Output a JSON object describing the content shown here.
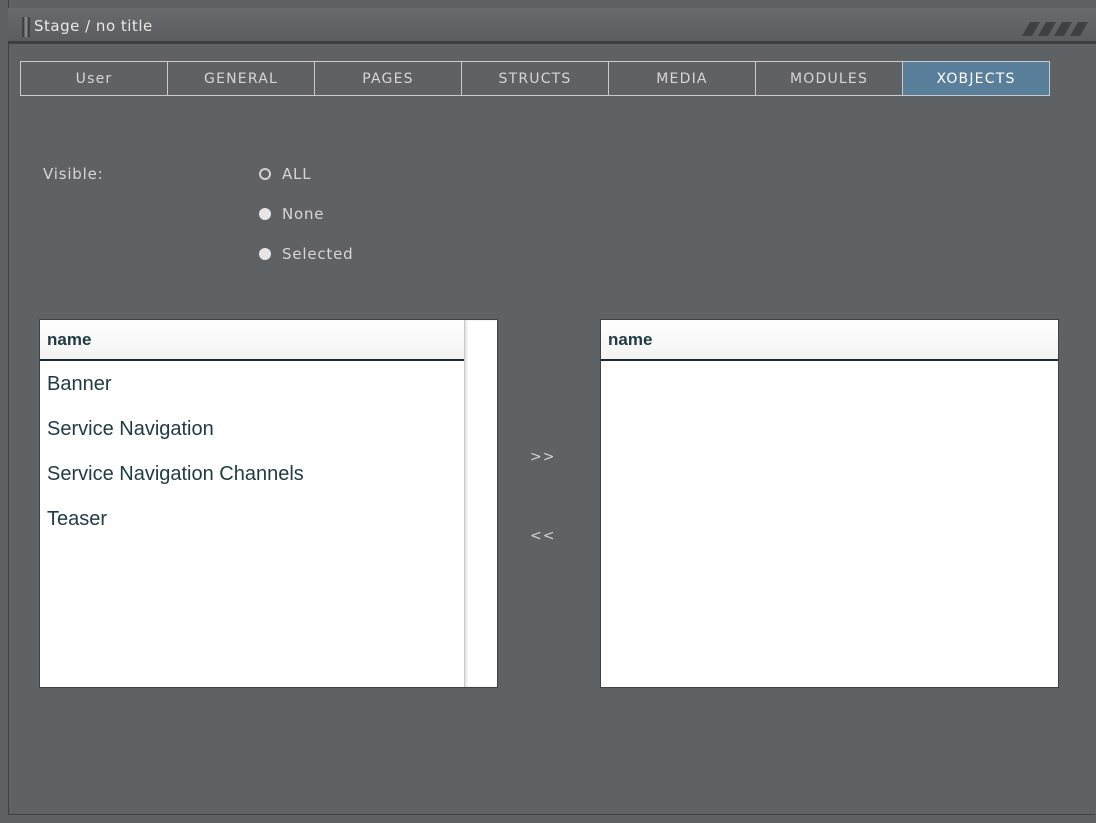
{
  "window": {
    "title": "Stage / no title"
  },
  "tabs": [
    {
      "label": "User",
      "active": false
    },
    {
      "label": "GENERAL",
      "active": false
    },
    {
      "label": "PAGES",
      "active": false
    },
    {
      "label": "STRUCTS",
      "active": false
    },
    {
      "label": "MEDIA",
      "active": false
    },
    {
      "label": "MODULES",
      "active": false
    },
    {
      "label": "XOBJECTS",
      "active": true
    }
  ],
  "visibility": {
    "label": "Visible:",
    "options": [
      {
        "label": "ALL",
        "selected": true
      },
      {
        "label": "None",
        "selected": false
      },
      {
        "label": "Selected",
        "selected": false
      }
    ]
  },
  "available_list": {
    "header": "name",
    "items": [
      "Banner",
      "Service Navigation",
      "Service Navigation Channels",
      "Teaser"
    ]
  },
  "selected_list": {
    "header": "name",
    "items": []
  },
  "transfer": {
    "add_label": ">>",
    "remove_label": "<<"
  },
  "colors": {
    "background": "#5e6265",
    "active_tab": "#5a7f9b",
    "list_text": "#1f3a44"
  }
}
